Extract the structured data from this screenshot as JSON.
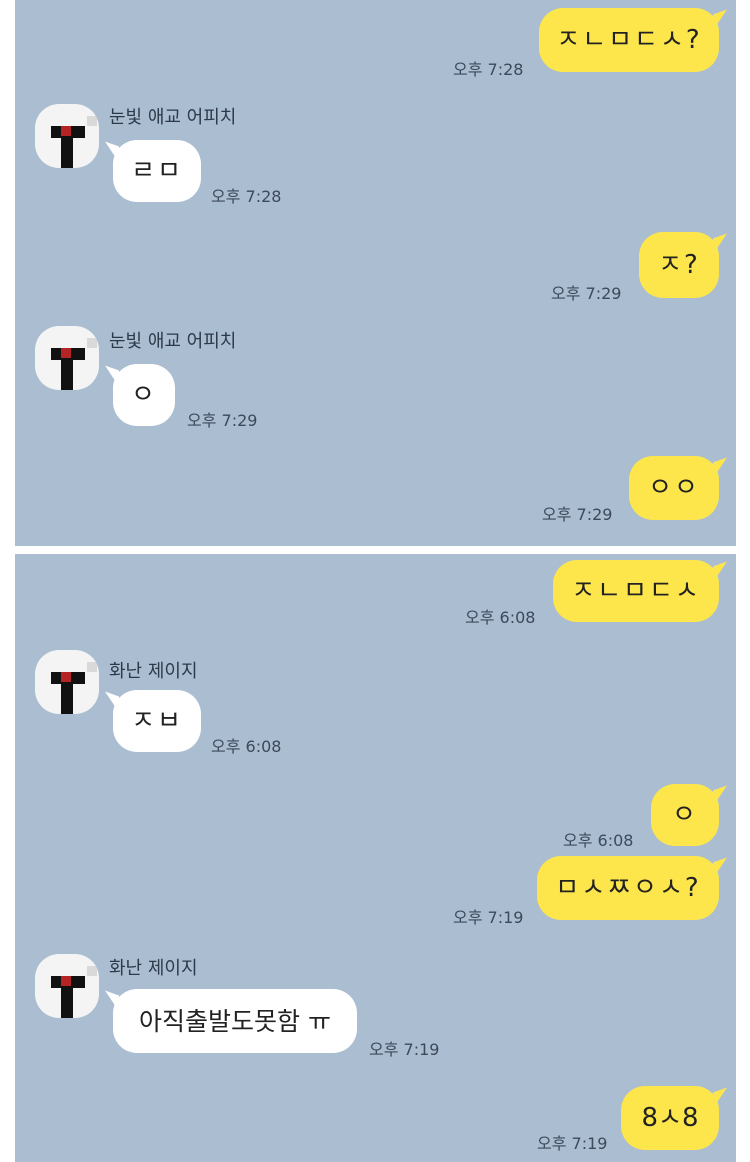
{
  "panel1": {
    "messages": [
      {
        "side": "out",
        "text": "ㅈㄴㅁㄷㅅ?",
        "time": "오후 7:28"
      },
      {
        "side": "in",
        "sender": "눈빛 애교 어피치",
        "text": "ㄹㅁ",
        "time": "오후 7:28"
      },
      {
        "side": "out",
        "text": "ㅈ?",
        "time": "오후 7:29"
      },
      {
        "side": "in",
        "sender": "눈빛 애교 어피치",
        "text": "ㅇ",
        "time": "오후 7:29"
      },
      {
        "side": "out",
        "text": "ㅇㅇ",
        "time": "오후 7:29"
      }
    ]
  },
  "panel2": {
    "messages": [
      {
        "side": "out",
        "text": "ㅈㄴㅁㄷㅅ",
        "time": "오후 6:08"
      },
      {
        "side": "in",
        "sender": "화난 제이지",
        "text": "ㅈㅂ",
        "time": "오후 6:08"
      },
      {
        "side": "out",
        "text": "ㅇ",
        "time": "오후 6:08"
      },
      {
        "side": "out",
        "text": "ㅁㅅㅉㅇㅅ?",
        "time": "오후 7:19"
      },
      {
        "side": "in",
        "sender": "화난 제이지",
        "text": "아직출발도못함 ㅠ",
        "time": "오후 7:19"
      },
      {
        "side": "out",
        "text": "8ㅅ8",
        "time": "오후 7:19"
      }
    ]
  }
}
